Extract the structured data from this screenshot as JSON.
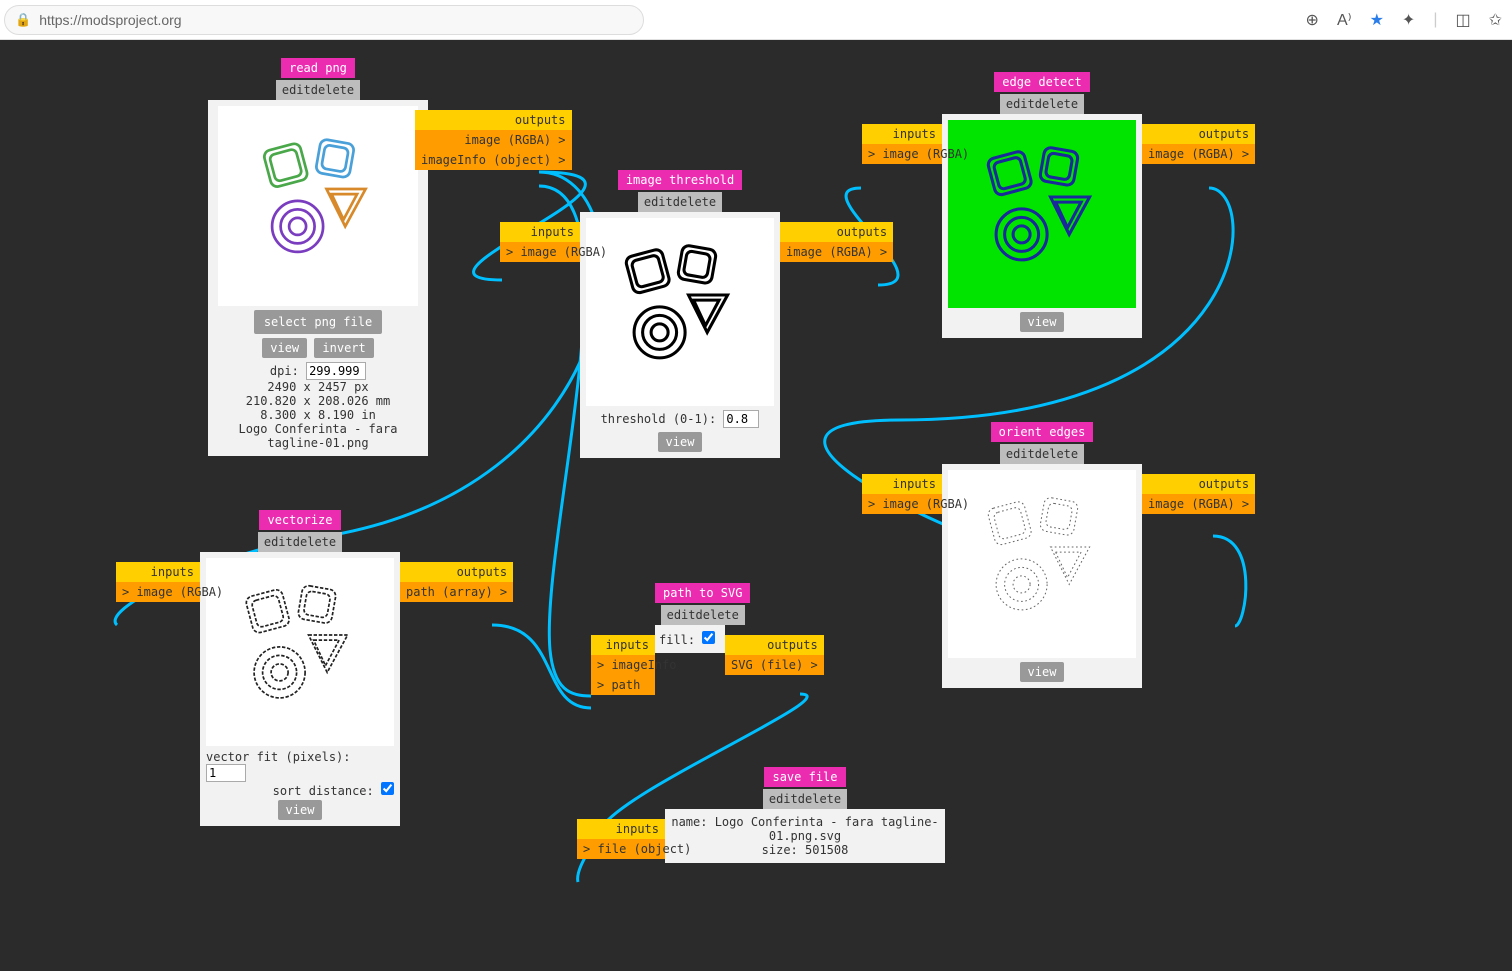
{
  "browser": {
    "url": "https://modsproject.org"
  },
  "nodes": {
    "readpng": {
      "title": "read png",
      "edit": "edit",
      "delete": "delete",
      "select": "select png file",
      "view": "view",
      "invert": "invert",
      "dpi_label": "dpi:",
      "dpi_value": "299.999",
      "px": "2490 x 2457 px",
      "mm": "210.820 x 208.026 mm",
      "in": "8.300 x 8.190 in",
      "filename": "Logo Conferinta - fara tagline-01.png",
      "outputs_head": "outputs",
      "out1": "image (RGBA) >",
      "out2": "imageInfo (object) >"
    },
    "threshold": {
      "title": "image threshold",
      "edit": "edit",
      "delete": "delete",
      "inputs_head": "inputs",
      "in1": "> image (RGBA)",
      "outputs_head": "outputs",
      "out1": "image (RGBA) >",
      "thresh_label": "threshold (0-1):",
      "thresh_value": "0.8",
      "view": "view"
    },
    "edgedetect": {
      "title": "edge detect",
      "edit": "edit",
      "delete": "delete",
      "inputs_head": "inputs",
      "in1": "> image (RGBA)",
      "outputs_head": "outputs",
      "out1": "image (RGBA) >",
      "view": "view"
    },
    "orient": {
      "title": "orient edges",
      "edit": "edit",
      "delete": "delete",
      "inputs_head": "inputs",
      "in1": "> image (RGBA)",
      "outputs_head": "outputs",
      "out1": "image (RGBA) >",
      "view": "view"
    },
    "vectorize": {
      "title": "vectorize",
      "edit": "edit",
      "delete": "delete",
      "inputs_head": "inputs",
      "in1": "> image (RGBA)",
      "outputs_head": "outputs",
      "out1": "path (array) >",
      "fit_label": "vector fit (pixels):",
      "fit_value": "1",
      "sort_label": "sort distance:",
      "view": "view"
    },
    "pathsvg": {
      "title": "path to SVG",
      "edit": "edit",
      "delete": "delete",
      "inputs_head": "inputs",
      "in1": "> imageInfo",
      "in2": "> path",
      "outputs_head": "outputs",
      "out1": "SVG (file) >",
      "fill_label": "fill:"
    },
    "savefile": {
      "title": "save file",
      "edit": "edit",
      "delete": "delete",
      "inputs_head": "inputs",
      "in1": "> file (object)",
      "name_line": "name: Logo Conferinta - fara tagline-01.png.svg",
      "size_line": "size: 501508"
    }
  }
}
